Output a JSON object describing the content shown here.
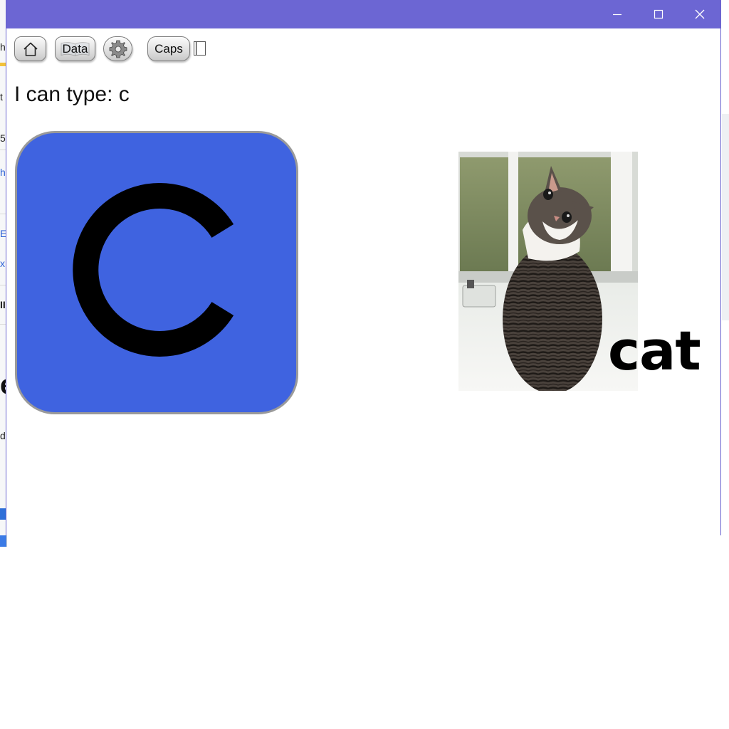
{
  "window": {
    "controls": {
      "minimize_icon": "minimize-icon",
      "maximize_icon": "maximize-icon",
      "close_icon": "close-icon"
    }
  },
  "toolbar": {
    "home_icon": "home-icon",
    "data_label": "Data",
    "settings_icon": "gear-icon",
    "caps_label": "Caps",
    "caps_checked": false
  },
  "status": {
    "text": "I can type: c"
  },
  "letter_card": {
    "letter": "c",
    "background_color": "#3f63e0"
  },
  "picture": {
    "subject": "cat",
    "word": "cat"
  },
  "background_window": {
    "fragments": [
      "h",
      "t",
      "5",
      "h",
      "E",
      "x",
      "II",
      "e",
      "d"
    ]
  },
  "colors": {
    "titlebar": "#6c66d3",
    "card": "#3f63e0"
  }
}
